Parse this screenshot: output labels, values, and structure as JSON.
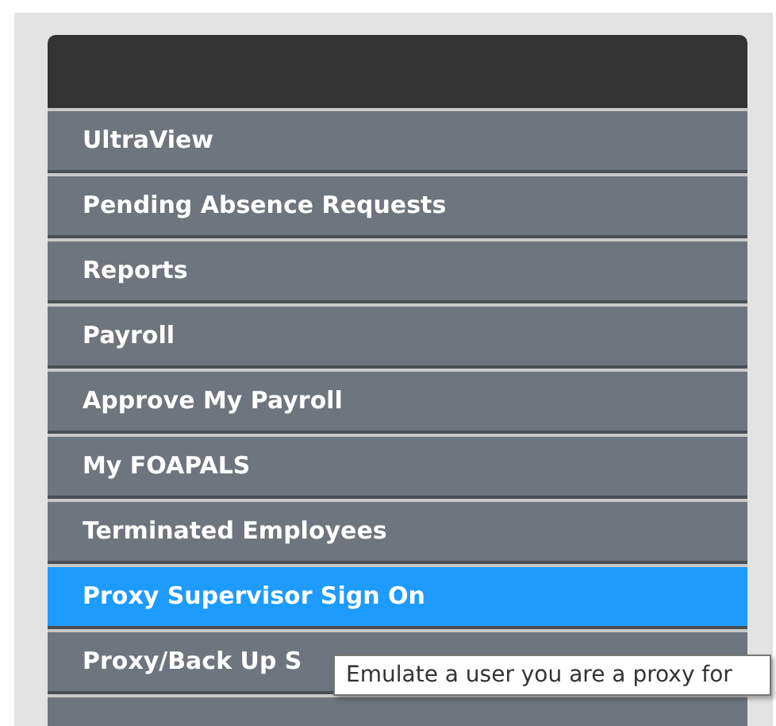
{
  "menu": {
    "items": [
      {
        "label": "UltraView",
        "selected": false
      },
      {
        "label": "Pending Absence Requests",
        "selected": false
      },
      {
        "label": "Reports",
        "selected": false
      },
      {
        "label": "Payroll",
        "selected": false
      },
      {
        "label": "Approve My Payroll",
        "selected": false
      },
      {
        "label": "My FOAPALS",
        "selected": false
      },
      {
        "label": "Terminated Employees",
        "selected": false
      },
      {
        "label": "Proxy Supervisor Sign On",
        "selected": true
      },
      {
        "label": "Proxy/Back Up S",
        "selected": false
      },
      {
        "selected": false
      }
    ]
  },
  "tooltip": {
    "text": "Emulate a user you are a proxy for"
  }
}
